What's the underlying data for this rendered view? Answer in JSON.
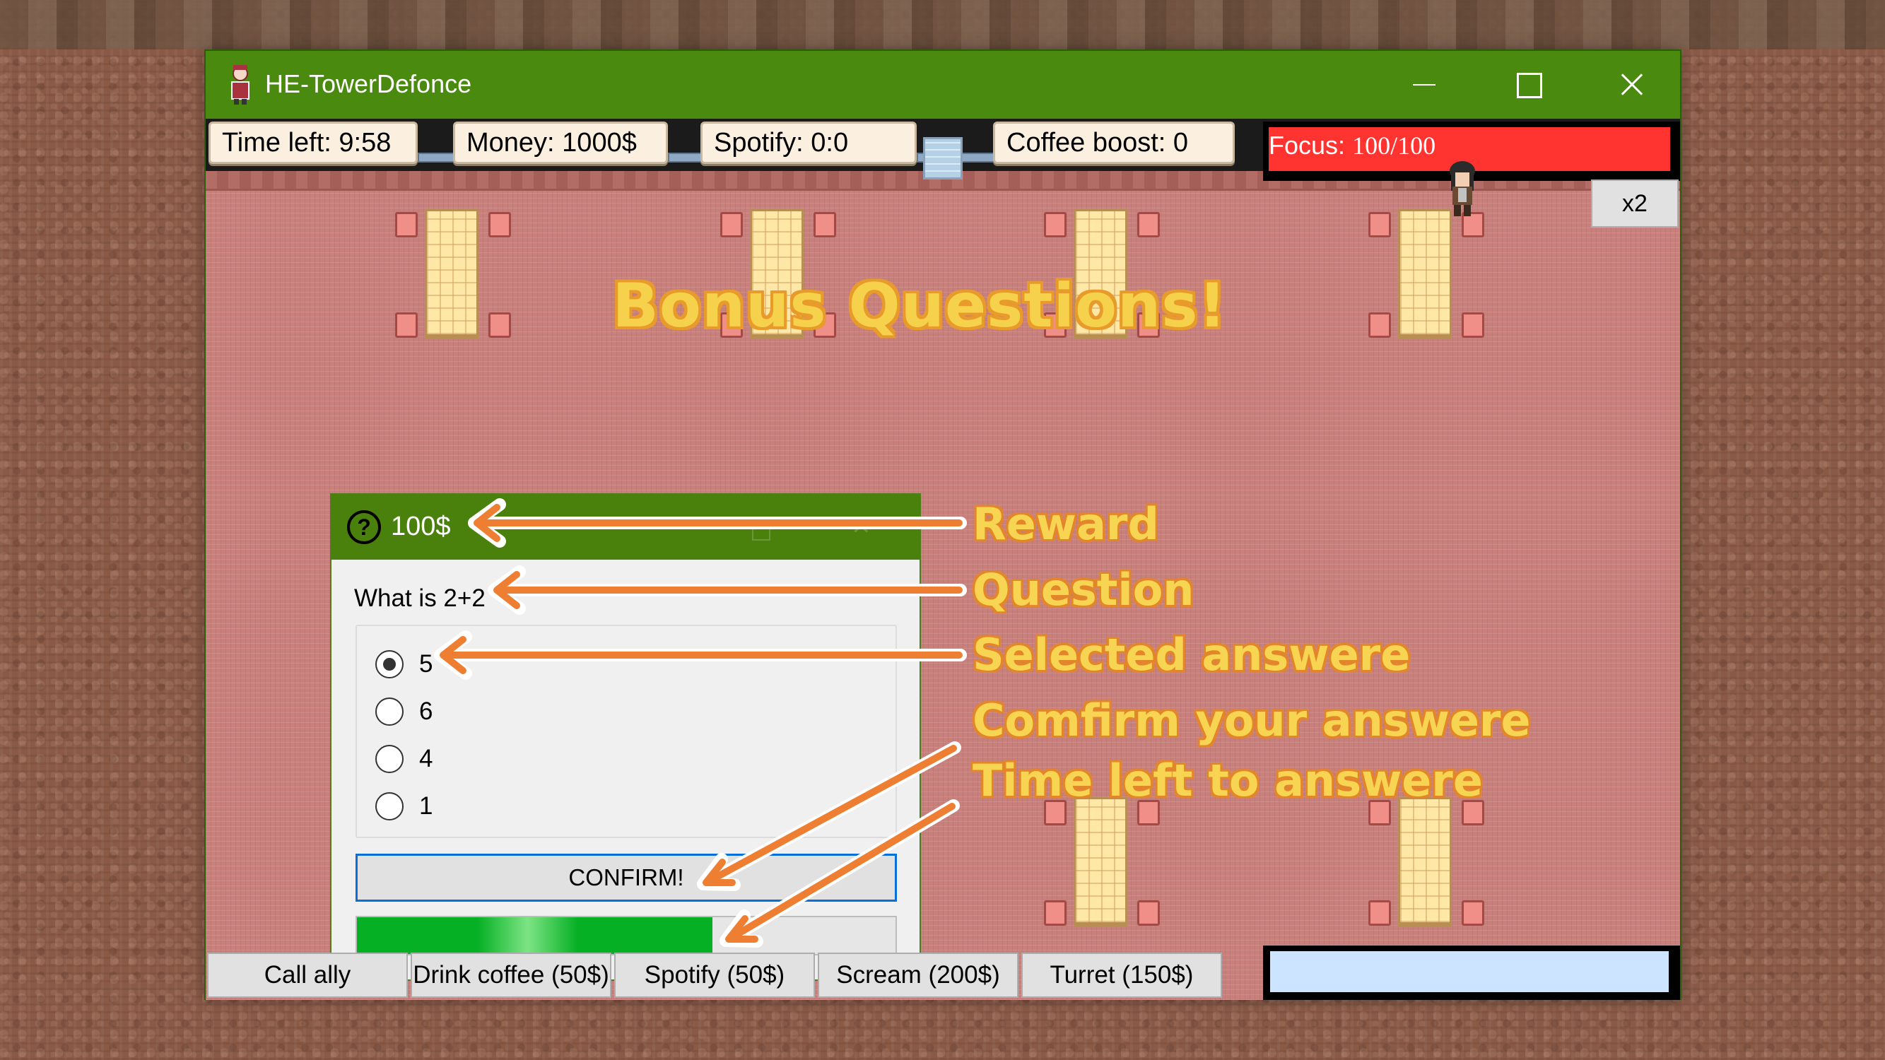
{
  "window": {
    "title": "HE-TowerDefonce"
  },
  "hud": {
    "time_left": "Time left: 9:58",
    "money": "Money: 1000$",
    "spotify": "Spotify: 0:0",
    "coffee_boost": "Coffee boost: 0",
    "focus_label": "Focus:",
    "focus_value": "100/100",
    "focus_fraction": 1.0,
    "speed_button": "x2"
  },
  "banner": "Bonus Questions!",
  "question_dialog": {
    "reward": "100$",
    "question": "What is 2+2",
    "options": [
      "5",
      "6",
      "4",
      "1"
    ],
    "selected_index": 0,
    "confirm_label": "CONFIRM!",
    "time_remaining_fraction": 0.66
  },
  "annotations": {
    "reward": "Reward",
    "question": "Question",
    "selected": "Selected answere",
    "confirm": "Comfirm your answere",
    "time": "Time left to answere"
  },
  "actions": [
    "Call ally",
    "Drink coffee (50$)",
    "Spotify (50$)",
    "Scream (200$)",
    "Turret (150$)"
  ],
  "colors": {
    "titlebar": "#4a8a0e",
    "focus_bar": "#ff3330",
    "annotation_text": "#f7d451",
    "arrow": "#ee7f32",
    "timer_fill": "#06b025"
  }
}
